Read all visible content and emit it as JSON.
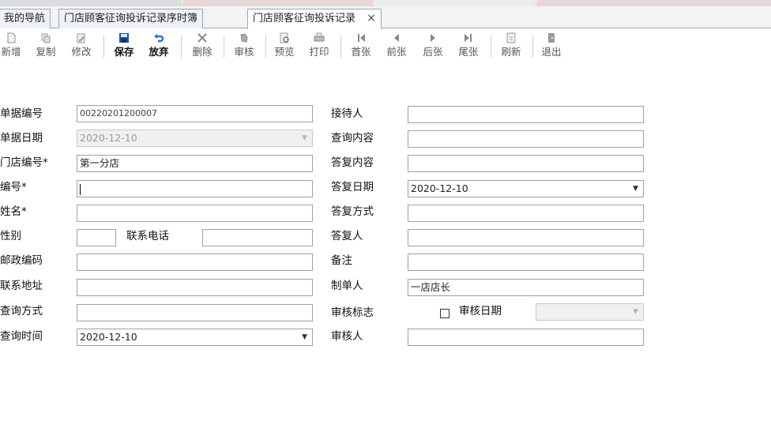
{
  "tabs": [
    {
      "label": "我的导航",
      "active": false
    },
    {
      "label": "门店顾客征询投诉记录序时簿",
      "active": false
    },
    {
      "label": "门店顾客征询投诉记录",
      "active": true
    }
  ],
  "tab_close_glyph": "×",
  "toolbar": {
    "new": "新增",
    "copy": "复制",
    "modify": "修改",
    "save": "保存",
    "discard": "放弃",
    "delete": "删除",
    "audit": "审核",
    "preview": "预览",
    "print": "打印",
    "first": "首张",
    "prev": "前张",
    "next": "后张",
    "last": "尾张",
    "refresh": "刷新",
    "exit": "退出"
  },
  "form": {
    "doc_no": {
      "label": "单据编号",
      "value": "00220201200007"
    },
    "doc_date": {
      "label": "单据日期",
      "value": "2020-12-10"
    },
    "store_no": {
      "label": "门店编号*",
      "value": "第一分店"
    },
    "code": {
      "label": "编号*",
      "value": ""
    },
    "name": {
      "label": "姓名*",
      "value": ""
    },
    "gender": {
      "label": "性别",
      "value": ""
    },
    "phone": {
      "label": "联系电话",
      "value": ""
    },
    "postcode": {
      "label": "邮政编码",
      "value": ""
    },
    "address": {
      "label": "联系地址",
      "value": ""
    },
    "query_method": {
      "label": "查询方式",
      "value": ""
    },
    "query_time": {
      "label": "查询时间",
      "value": "2020-12-10"
    },
    "receiver": {
      "label": "接待人",
      "value": ""
    },
    "query_content": {
      "label": "查询内容",
      "value": ""
    },
    "reply_content": {
      "label": "答复内容",
      "value": ""
    },
    "reply_date": {
      "label": "答复日期",
      "value": "2020-12-10"
    },
    "reply_method": {
      "label": "答复方式",
      "value": ""
    },
    "replier": {
      "label": "答复人",
      "value": ""
    },
    "remark": {
      "label": "备注",
      "value": ""
    },
    "maker": {
      "label": "制单人",
      "value": "一店店长"
    },
    "audit_flag": {
      "label": "审核标志",
      "checked": false
    },
    "audit_date": {
      "label": "审核日期",
      "value": ""
    },
    "auditor": {
      "label": "审核人",
      "value": ""
    }
  },
  "colors": {
    "tab_border": "#9aa9bb",
    "save_icon": "#1f4f9c",
    "discard_icon": "#2a6fd0",
    "field_border": "#a0a0a0"
  }
}
